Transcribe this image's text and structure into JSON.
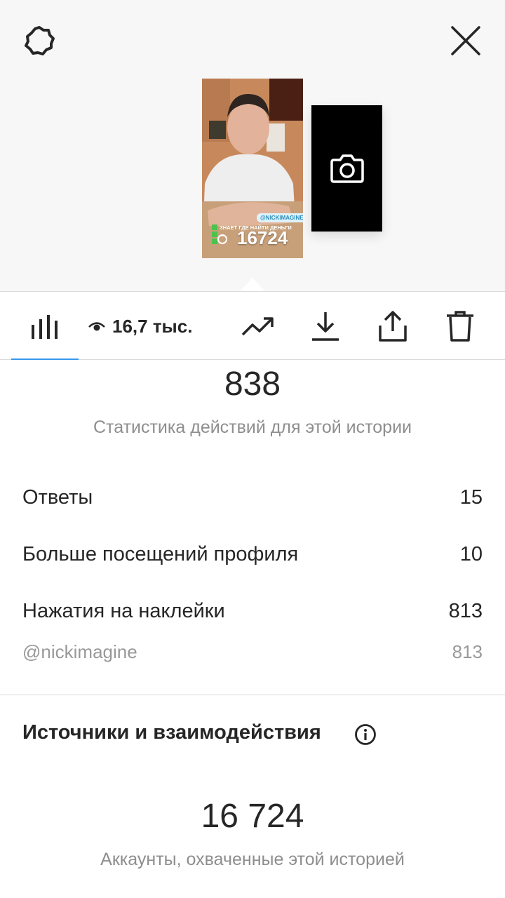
{
  "header": {
    "settings_icon": "gear-icon",
    "close_icon": "close-icon"
  },
  "story": {
    "mention": "@NICKIMAGINE",
    "sticker_lines": [
      "ЗНАЕТ ГДЕ НАЙТИ ДЕНЬГИ",
      "...",
      "..."
    ],
    "count": "16724"
  },
  "toolbar": {
    "views": "16,7 тыс.",
    "accent": "#3897f0"
  },
  "actions": {
    "total": "838",
    "label": "Статистика действий для этой истории",
    "rows": [
      {
        "label": "Ответы",
        "value": "15"
      },
      {
        "label": "Больше посещений профиля",
        "value": "10"
      },
      {
        "label": "Нажатия на наклейки",
        "value": "813"
      }
    ],
    "sub_row": {
      "label": "@nickimagine",
      "value": "813"
    }
  },
  "discovery": {
    "title": "Источники и взаимодействия",
    "total": "16 724",
    "label": "Аккаунты, охваченные этой историей"
  }
}
